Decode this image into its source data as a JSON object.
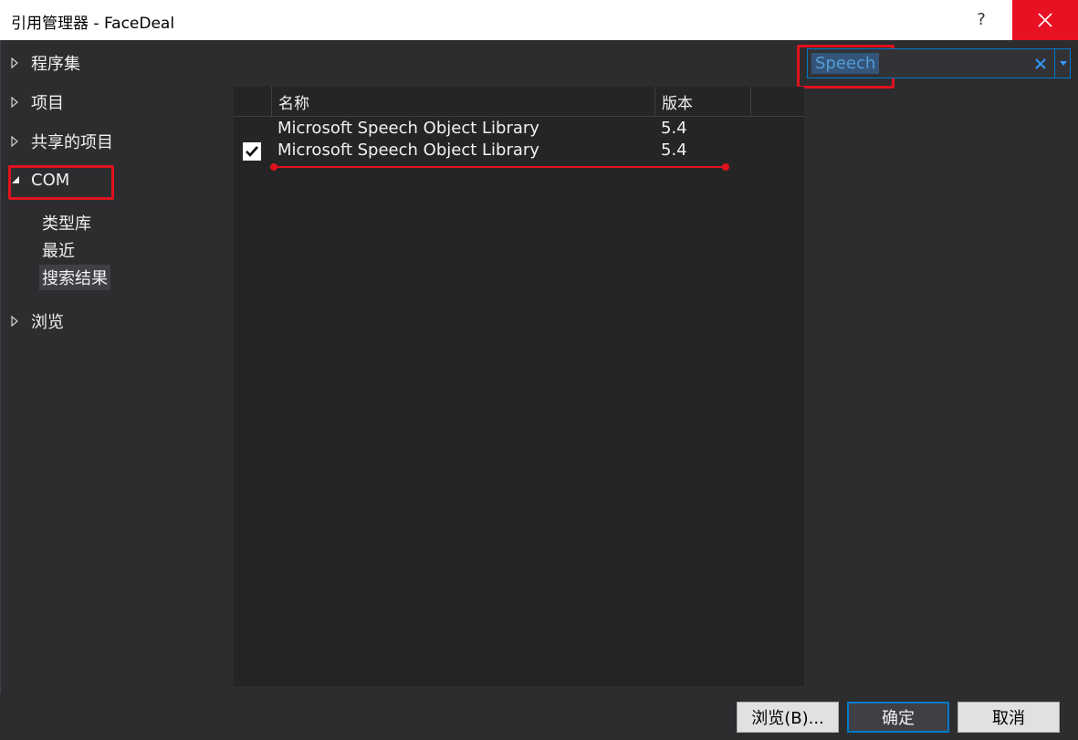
{
  "window": {
    "title": "引用管理器 - FaceDeal",
    "help_label": "?",
    "close_icon": "close-icon"
  },
  "tree": {
    "items": [
      {
        "label": "程序集",
        "expanded": false
      },
      {
        "label": "项目",
        "expanded": false
      },
      {
        "label": "共享的项目",
        "expanded": false
      },
      {
        "label": "COM",
        "expanded": true
      },
      {
        "label": "浏览",
        "expanded": false
      }
    ],
    "com_children": [
      {
        "label": "类型库"
      },
      {
        "label": "最近"
      },
      {
        "label": "搜索结果",
        "selected": true
      }
    ]
  },
  "search": {
    "value": "Speech",
    "clear_icon": "close-icon",
    "dropdown_icon": "chevron-down-icon"
  },
  "list": {
    "columns": [
      "名称",
      "版本"
    ],
    "rows": [
      {
        "checked": false,
        "name": "Microsoft Speech Object Library",
        "version": "5.4"
      },
      {
        "checked": true,
        "name": "Microsoft Speech Object Library",
        "version": "5.4"
      }
    ]
  },
  "buttons": {
    "browse": "浏览(B)...",
    "ok": "确定",
    "cancel": "取消"
  },
  "colors": {
    "accent": "#007acc",
    "highlight": "#e0121c",
    "close": "#e81123",
    "background": "#2d2d30"
  }
}
